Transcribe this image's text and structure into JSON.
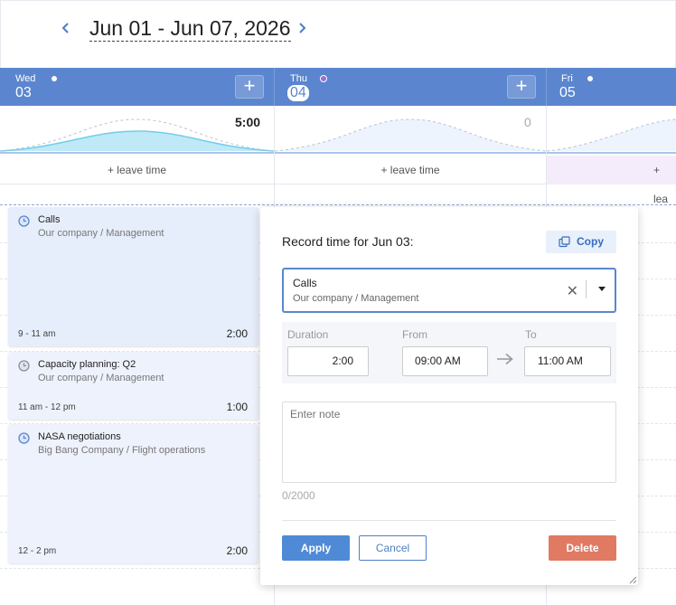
{
  "range": {
    "title": "Jun 01 - Jun 07, 2026"
  },
  "days": [
    {
      "name": "Wed",
      "num": "03",
      "total": "5:00",
      "leave": "+ leave time",
      "load": 0.55
    },
    {
      "name": "Thu",
      "num": "04",
      "total": "0",
      "leave": "+ leave time",
      "load": 0
    },
    {
      "name": "Fri",
      "num": "05",
      "total": "",
      "leave": "+ lea",
      "load": 0
    }
  ],
  "entries": [
    {
      "title": "Calls",
      "sub": "Our company / Management",
      "time": "9 - 11 am",
      "duration": "2:00"
    },
    {
      "title": "Capacity planning: Q2",
      "sub": "Our company / Management",
      "time": "11 am - 12 pm",
      "duration": "1:00"
    },
    {
      "title": "NASA negotiations",
      "sub": "Big Bang Company / Flight operations",
      "time": "12 - 2 pm",
      "duration": "2:00"
    }
  ],
  "popup": {
    "title": "Record time for Jun 03:",
    "copy_label": "Copy",
    "task": {
      "name": "Calls",
      "sub": "Our company / Management"
    },
    "duration_label": "Duration",
    "from_label": "From",
    "to_label": "To",
    "duration": "2:00",
    "from": "09:00 AM",
    "to": "11:00 AM",
    "note_placeholder": "Enter note",
    "counter": "0/2000",
    "apply": "Apply",
    "cancel": "Cancel",
    "delete": "Delete"
  },
  "colors": {
    "header_blue": "#5b86cf",
    "curve_fill": "#bfe9f7",
    "apply": "#4f8ad6",
    "delete": "#e07a62",
    "today_dot": "#9b6bd6"
  },
  "icons": {
    "prev": "chevron-left-icon",
    "next": "chevron-right-icon",
    "add": "plus-icon",
    "clock": "clock-icon",
    "copy": "copy-icon",
    "clear": "clear-icon",
    "caret": "caret-down-icon",
    "arrow": "arrow-right-icon"
  }
}
